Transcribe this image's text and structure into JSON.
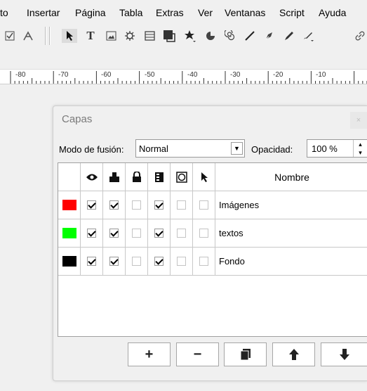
{
  "menubar": {
    "items": [
      "to",
      "Insertar",
      "Página",
      "Tabla",
      "Extras",
      "Ver",
      "Ventanas",
      "Script",
      "Ayuda"
    ]
  },
  "toolbar": {
    "icons": [
      "checkbox-icon",
      "pdf-icon",
      "pointer-icon",
      "text-icon",
      "image-icon",
      "gear-icon",
      "table-icon",
      "shape-icon",
      "star-icon",
      "arc-icon",
      "spiral-icon",
      "line-icon",
      "pen-icon",
      "pencil-icon",
      "brush-icon",
      "link-icon"
    ]
  },
  "ruler": {
    "labels": [
      "-80",
      "-70",
      "-60",
      "-50",
      "-40",
      "-30",
      "-20",
      "-10"
    ]
  },
  "layers_panel": {
    "title": "Capas",
    "close_label": "×",
    "blend_mode_label": "Modo de fusión:",
    "blend_mode_value": "Normal",
    "opacity_label": "Opacidad:",
    "opacity_value": "100 %",
    "header": {
      "name_label": "Nombre",
      "icons": [
        "eye-icon",
        "print-icon",
        "lock-icon",
        "flow-icon",
        "outline-icon",
        "select-icon"
      ]
    },
    "layers": [
      {
        "name": "Imágenes",
        "color": "#ff0000",
        "visible": true,
        "print": true,
        "locked": false,
        "flow": true,
        "outline": false,
        "select": false
      },
      {
        "name": "textos",
        "color": "#00ff00",
        "visible": true,
        "print": true,
        "locked": false,
        "flow": true,
        "outline": false,
        "select": false
      },
      {
        "name": "Fondo",
        "color": "#000000",
        "visible": true,
        "print": true,
        "locked": false,
        "flow": true,
        "outline": false,
        "select": false
      }
    ],
    "buttons": [
      {
        "name": "add-layer-button",
        "label": "+"
      },
      {
        "name": "remove-layer-button",
        "label": "−"
      },
      {
        "name": "duplicate-layer-button",
        "label": "▮"
      },
      {
        "name": "raise-layer-button",
        "label": "🡅"
      },
      {
        "name": "lower-layer-button",
        "label": "🡇"
      }
    ]
  }
}
